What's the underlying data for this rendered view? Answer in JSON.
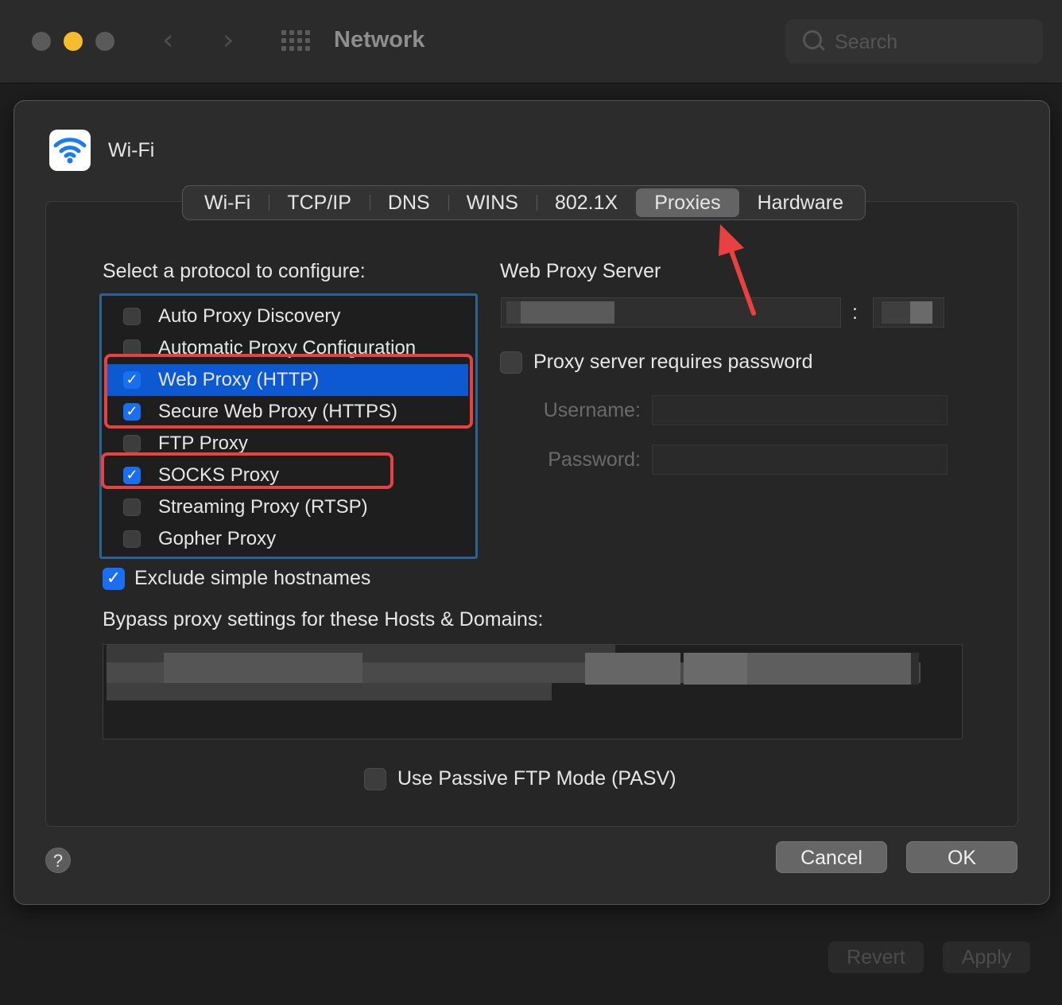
{
  "window": {
    "title": "Network",
    "search_placeholder": "Search",
    "revert_label": "Revert",
    "apply_label": "Apply"
  },
  "sheet": {
    "title": "Wi-Fi",
    "tabs": [
      {
        "label": "Wi-Fi",
        "selected": false
      },
      {
        "label": "TCP/IP",
        "selected": false
      },
      {
        "label": "DNS",
        "selected": false
      },
      {
        "label": "WINS",
        "selected": false
      },
      {
        "label": "802.1X",
        "selected": false
      },
      {
        "label": "Proxies",
        "selected": true
      },
      {
        "label": "Hardware",
        "selected": false
      }
    ],
    "protocol_label": "Select a protocol to configure:",
    "protocols": [
      {
        "label": "Auto Proxy Discovery",
        "checked": false
      },
      {
        "label": "Automatic Proxy Configuration",
        "checked": false
      },
      {
        "label": "Web Proxy (HTTP)",
        "checked": true,
        "selected": true
      },
      {
        "label": "Secure Web Proxy (HTTPS)",
        "checked": true
      },
      {
        "label": "FTP Proxy",
        "checked": false
      },
      {
        "label": "SOCKS Proxy",
        "checked": true
      },
      {
        "label": "Streaming Proxy (RTSP)",
        "checked": false
      },
      {
        "label": "Gopher Proxy",
        "checked": false
      }
    ],
    "server_label": "Web Proxy Server",
    "colon": ":",
    "requires_password_label": "Proxy server requires password",
    "username_label": "Username:",
    "password_label": "Password:",
    "exclude_simple_label": "Exclude simple hostnames",
    "bypass_label": "Bypass proxy settings for these Hosts & Domains:",
    "pasv_label": "Use Passive FTP Mode (PASV)",
    "help_label": "?",
    "cancel_label": "Cancel",
    "ok_label": "OK"
  },
  "colors": {
    "selection_blue": "#0d59d1",
    "checkbox_blue": "#1a6ff0",
    "annotation_red": "#e94040",
    "list_border_blue": "#2a6497"
  }
}
